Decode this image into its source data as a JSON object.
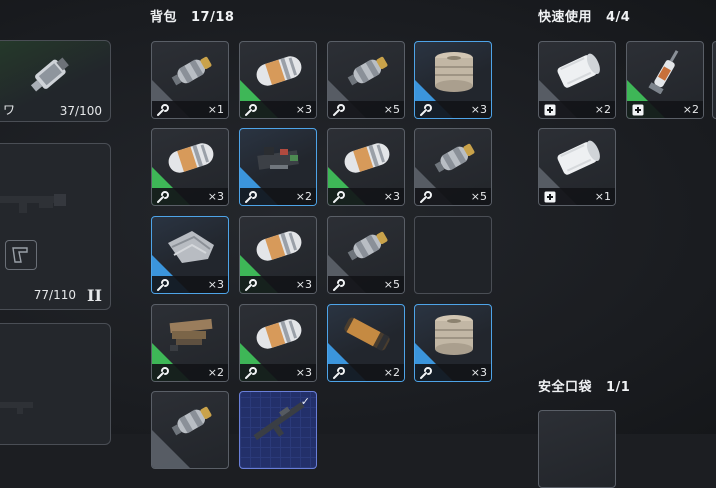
{
  "backpack": {
    "title": "背包",
    "count": "17/18"
  },
  "quick_use": {
    "title": "快速使用",
    "count": "4/4"
  },
  "safe_pocket": {
    "title": "安全口袋",
    "count": "1/1"
  },
  "left_panel": {
    "top_label_fragment": "ワ",
    "top_value": "37/100",
    "weapon_value": "77/110",
    "weapon_tier": "II"
  },
  "backpack_items": [
    {
      "art": "grenade",
      "rarity": "gray",
      "icon": "wrench-icon",
      "qty": "×1"
    },
    {
      "art": "capsule",
      "rarity": "green",
      "icon": "wrench-icon",
      "qty": "×3"
    },
    {
      "art": "grenade",
      "rarity": "gray",
      "icon": "wrench-icon",
      "qty": "×5"
    },
    {
      "art": "drum",
      "rarity": "blue",
      "icon": "wrench-icon",
      "qty": "×3"
    },
    {
      "art": "capsule",
      "rarity": "green",
      "icon": "wrench-icon",
      "qty": "×3"
    },
    {
      "art": "circuit",
      "rarity": "blue",
      "icon": "wrench-icon",
      "qty": "×2"
    },
    {
      "art": "capsule",
      "rarity": "green",
      "icon": "wrench-icon",
      "qty": "×3"
    },
    {
      "art": "grenade",
      "rarity": "gray",
      "icon": "wrench-icon",
      "qty": "×5"
    },
    {
      "art": "cloth",
      "rarity": "blue",
      "icon": "wrench-icon",
      "qty": "×3"
    },
    {
      "art": "capsule",
      "rarity": "green",
      "icon": "wrench-icon",
      "qty": "×3"
    },
    {
      "art": "grenade",
      "rarity": "gray",
      "icon": "wrench-icon",
      "qty": "×5"
    },
    {
      "art": "empty",
      "rarity": "none",
      "icon": "",
      "qty": ""
    },
    {
      "art": "crate",
      "rarity": "green",
      "icon": "wrench-icon",
      "qty": "×2"
    },
    {
      "art": "capsule",
      "rarity": "green",
      "icon": "wrench-icon",
      "qty": "×3"
    },
    {
      "art": "tube",
      "rarity": "blue",
      "icon": "wrench-icon",
      "qty": "×2"
    },
    {
      "art": "drum",
      "rarity": "blue",
      "icon": "wrench-icon",
      "qty": "×3"
    }
  ],
  "backpack_partial": [
    {
      "art": "grenade",
      "rarity": "gray"
    },
    {
      "art": "rifle",
      "rarity": "blue-grid"
    }
  ],
  "quick_items": [
    {
      "art": "bandage",
      "rarity": "gray",
      "icon": "medical-cross-icon",
      "qty": "×2"
    },
    {
      "art": "syringe",
      "rarity": "green",
      "icon": "medical-cross-icon",
      "qty": "×2"
    },
    {
      "art": "bandage",
      "rarity": "gray",
      "icon": "medical-cross-icon",
      "qty": "×1"
    }
  ],
  "colors": {
    "green": "#3fbf5a",
    "blue": "#3d9be6",
    "gray": "#5a5f67"
  }
}
